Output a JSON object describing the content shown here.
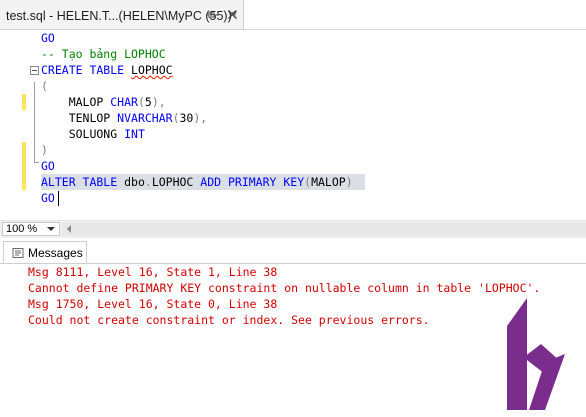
{
  "tab": {
    "title": "test.sql - HELEN.T...(HELEN\\MyPC (55))*",
    "pin_icon": "pin-icon",
    "close_icon": "close-icon"
  },
  "editor": {
    "lines": [
      {
        "segments": [
          {
            "t": "GO",
            "c": "kw"
          }
        ]
      },
      {
        "segments": [
          {
            "t": "-- Tạo bảng LOPHOC",
            "c": "cm"
          }
        ]
      },
      {
        "segments": [
          {
            "t": "CREATE TABLE ",
            "c": "kw"
          },
          {
            "t": "LOPHOC",
            "c": "wavy"
          }
        ]
      },
      {
        "segments": [
          {
            "t": "(",
            "c": "gr"
          }
        ]
      },
      {
        "segments": [
          {
            "t": "    MALOP ",
            "c": ""
          },
          {
            "t": "CHAR",
            "c": "kw"
          },
          {
            "t": "(",
            "c": "gr"
          },
          {
            "t": "5",
            "c": ""
          },
          {
            "t": "),",
            "c": "gr"
          }
        ]
      },
      {
        "segments": [
          {
            "t": "    TENLOP ",
            "c": ""
          },
          {
            "t": "NVARCHAR",
            "c": "kw"
          },
          {
            "t": "(",
            "c": "gr"
          },
          {
            "t": "30",
            "c": ""
          },
          {
            "t": "),",
            "c": "gr"
          }
        ]
      },
      {
        "segments": [
          {
            "t": "    SOLUONG ",
            "c": ""
          },
          {
            "t": "INT",
            "c": "kw"
          }
        ]
      },
      {
        "segments": [
          {
            "t": ")",
            "c": "gr"
          }
        ]
      },
      {
        "segments": [
          {
            "t": "GO",
            "c": "kw"
          }
        ]
      },
      {
        "segments": [
          {
            "t": "ALTER TABLE ",
            "c": "kw"
          },
          {
            "t": "dbo",
            "c": ""
          },
          {
            "t": ".",
            "c": "gr"
          },
          {
            "t": "LOPHOC ",
            "c": ""
          },
          {
            "t": "ADD PRIMARY KEY",
            "c": "kw"
          },
          {
            "t": "(",
            "c": "gr"
          },
          {
            "t": "MALOP",
            "c": ""
          },
          {
            "t": ")",
            "c": "gr"
          }
        ]
      },
      {
        "segments": [
          {
            "t": "GO",
            "c": "kw"
          }
        ]
      }
    ]
  },
  "zoom": {
    "value": "100 %"
  },
  "results": {
    "tab_label": "Messages",
    "messages": [
      "Msg 8111, Level 16, State 1, Line 38",
      "Cannot define PRIMARY KEY constraint on nullable column in table 'LOPHOC'.",
      "Msg 1750, Level 16, State 0, Line 38",
      "Could not create constraint or index. See previous errors."
    ]
  },
  "colors": {
    "keyword": "#0000ff",
    "comment": "#008000",
    "error": "#d40000",
    "logo": "#7b2d8e"
  }
}
